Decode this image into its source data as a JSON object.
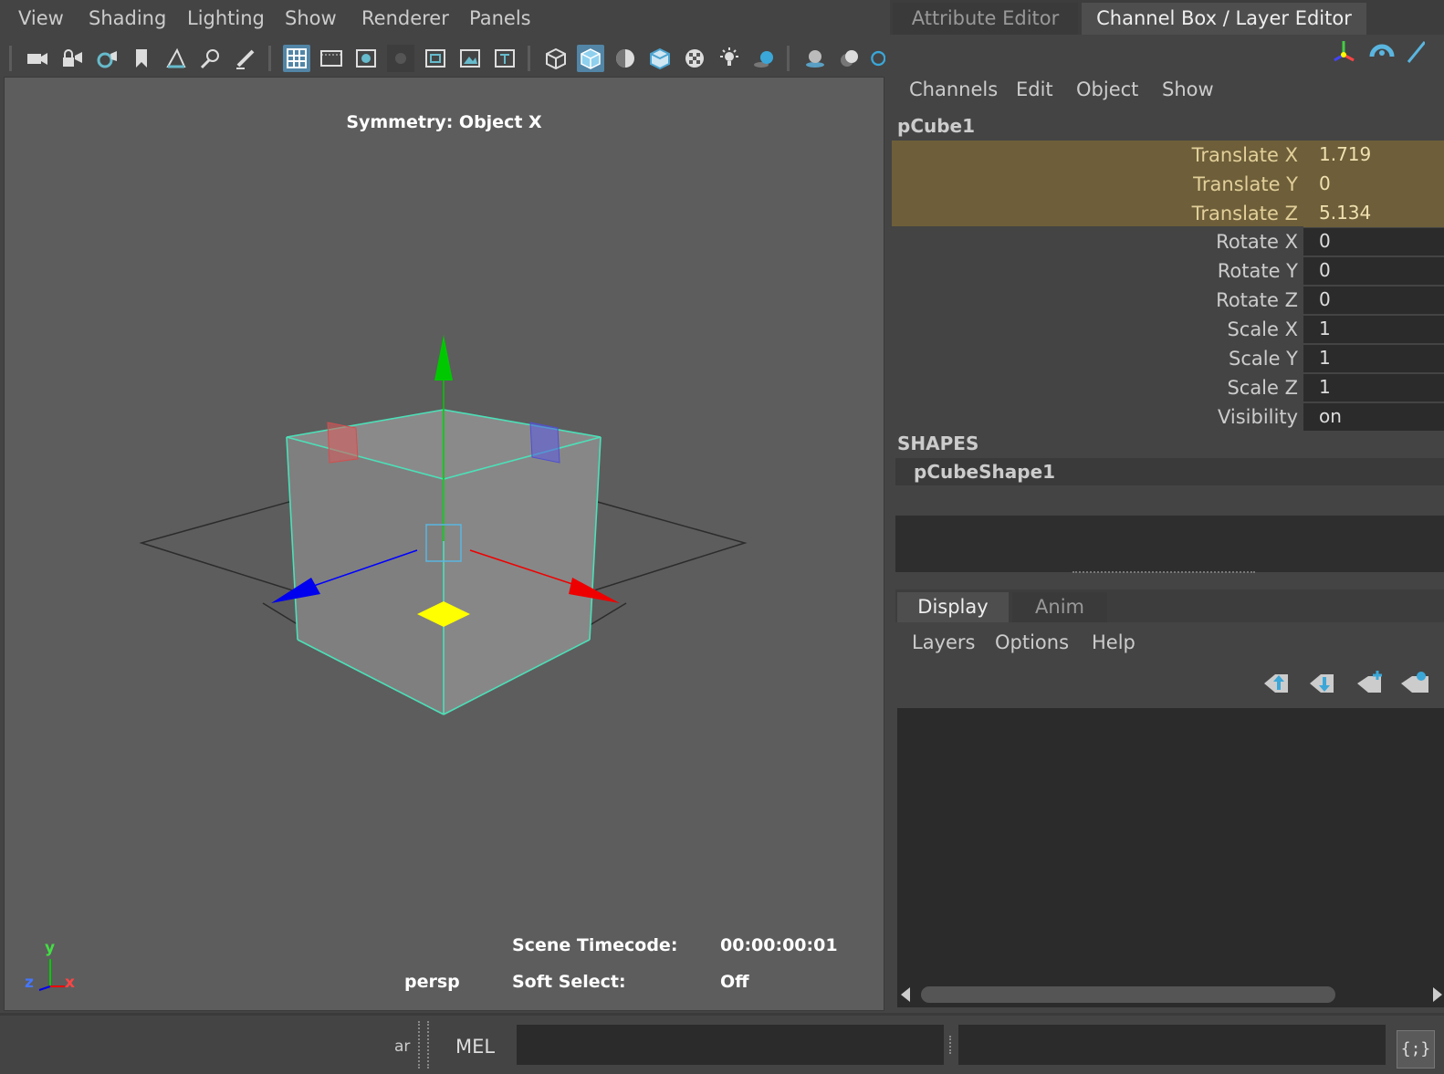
{
  "viewport": {
    "menus": [
      "View",
      "Shading",
      "Lighting",
      "Show",
      "Renderer",
      "Panels"
    ],
    "hud": {
      "symmetry": "Symmetry: Object X",
      "camera": "persp",
      "timecode_label": "Scene Timecode:",
      "timecode_value": "00:00:00:01",
      "soft_select_label": "Soft Select:",
      "soft_select_value": "Off"
    },
    "axis_labels": {
      "y": "y",
      "z": "z",
      "x": "x"
    },
    "colors": {
      "wireframe_selected": "#4de0b8",
      "axis_x": "#ff0000",
      "axis_y": "#00cc00",
      "axis_z": "#0000ff",
      "pivot": "#ffff00"
    }
  },
  "right_panel": {
    "tabs": [
      "Attribute Editor",
      "Channel Box / Layer Editor"
    ],
    "menus": [
      "Channels",
      "Edit",
      "Object",
      "Show"
    ],
    "object_name": "pCube1",
    "channels": [
      {
        "label": "Translate X",
        "value": "1.719",
        "highlighted": true
      },
      {
        "label": "Translate Y",
        "value": "0",
        "highlighted": true
      },
      {
        "label": "Translate Z",
        "value": "5.134",
        "highlighted": true
      },
      {
        "label": "Rotate X",
        "value": "0"
      },
      {
        "label": "Rotate Y",
        "value": "0"
      },
      {
        "label": "Rotate Z",
        "value": "0"
      },
      {
        "label": "Scale X",
        "value": "1"
      },
      {
        "label": "Scale Y",
        "value": "1"
      },
      {
        "label": "Scale Z",
        "value": "1"
      },
      {
        "label": "Visibility",
        "value": "on"
      }
    ],
    "shapes_heading": "SHAPES",
    "shape_name": "pCubeShape1",
    "layer_tabs": [
      "Display",
      "Anim"
    ],
    "layer_menus": [
      "Layers",
      "Options",
      "Help"
    ]
  },
  "command_line": {
    "left_fragment": "ar",
    "language": "MEL",
    "script_editor_icon": "{;}"
  }
}
